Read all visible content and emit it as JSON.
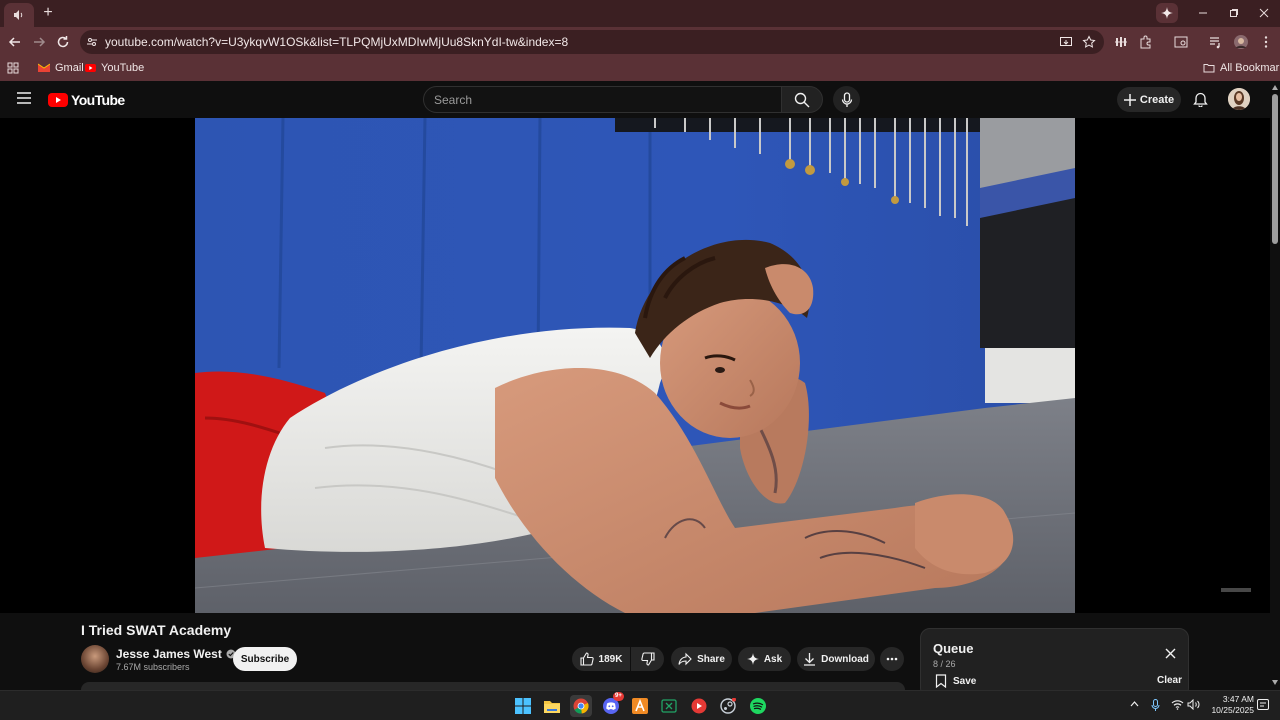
{
  "browser": {
    "url": "youtube.com/watch?v=U3ykqvW1OSk&list=TLPQMjUxMDIwMjUu8SknYdI-tw&index=8",
    "bookmarks": [
      {
        "label": "Gmail",
        "icon": "gmail-icon"
      },
      {
        "label": "YouTube",
        "icon": "youtube-icon"
      }
    ],
    "all_bookmarks": "All Bookmarks",
    "theme_colors": {
      "tabstrip": "#3b1f22",
      "toolbar": "#5a3136"
    }
  },
  "youtube": {
    "logo_text": "YouTube",
    "search_placeholder": "Search",
    "create_label": "Create"
  },
  "video": {
    "title": "I Tried SWAT Academy",
    "channel": "Jesse James West",
    "subscribers": "7.67M subscribers",
    "subscribe_label": "Subscribe",
    "likes": "189K",
    "share_label": "Share",
    "ask_label": "Ask",
    "download_label": "Download"
  },
  "queue": {
    "title": "Queue",
    "position": "8 / 26",
    "save_label": "Save",
    "clear_label": "Clear"
  },
  "taskbar": {
    "time": "3:47 AM",
    "date": "10/25/2025",
    "apps": [
      "windows-start-icon",
      "file-explorer-icon",
      "chrome-icon",
      "discord-icon",
      "app-a-icon",
      "excel-icon",
      "youtube-music-icon",
      "steam-icon",
      "spotify-icon"
    ],
    "discord_badge": "9+"
  }
}
